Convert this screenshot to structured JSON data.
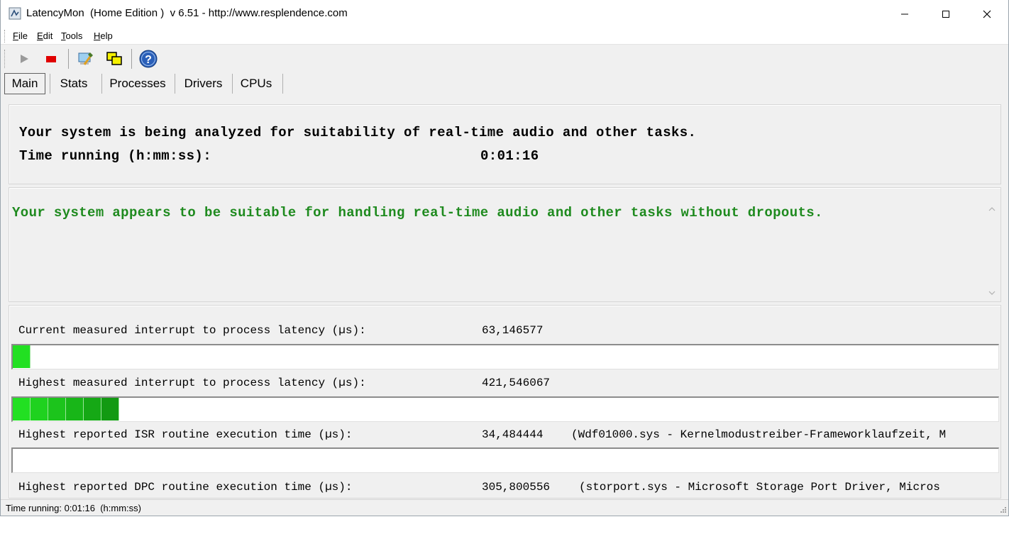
{
  "window": {
    "title": "LatencyMon  (Home Edition )  v 6.51 - http://www.resplendence.com"
  },
  "menu": [
    "File",
    "Edit",
    "Tools",
    "Help"
  ],
  "toolbar": {
    "buttons": [
      "play-icon",
      "stop-icon",
      "tools-icon",
      "windows-icon",
      "help-icon"
    ]
  },
  "tabs": [
    "Main",
    "Stats",
    "Processes",
    "Drivers",
    "CPUs"
  ],
  "active_tab": "Main",
  "analysis": {
    "line1": "Your system is being analyzed for suitability of real-time audio and other tasks.",
    "time_label": "Time running (h:mm:ss):",
    "time_value": "0:01:16"
  },
  "verdict": {
    "text": "Your system appears to be suitable for handling real-time audio and other tasks without dropouts."
  },
  "metrics": [
    {
      "label": "Current measured interrupt to process latency (µs):",
      "value": "63,146577",
      "detail": "",
      "bar_segments": 1
    },
    {
      "label": "Highest measured interrupt to process latency (µs):",
      "value": "421,546067",
      "detail": "",
      "bar_segments": 6
    },
    {
      "label": "Highest reported ISR routine execution time (µs):",
      "value": "34,484444",
      "detail": "(Wdf01000.sys - Kernelmodustreiber-Frameworklaufzeit, M",
      "bar_segments": 0
    },
    {
      "label": "Highest reported DPC routine execution time (µs):",
      "value": "305,800556",
      "detail": "(storport.sys - Microsoft Storage Port Driver, Micros",
      "bar_segments": null
    }
  ],
  "colors": {
    "verdict_text": "#1e8a1e",
    "bar_green_light": "#22e022",
    "bar_green_dark": "#129a12",
    "stop_red": "#e00000"
  },
  "status": {
    "text": "Time running: 0:01:16  (h:mm:ss)"
  }
}
